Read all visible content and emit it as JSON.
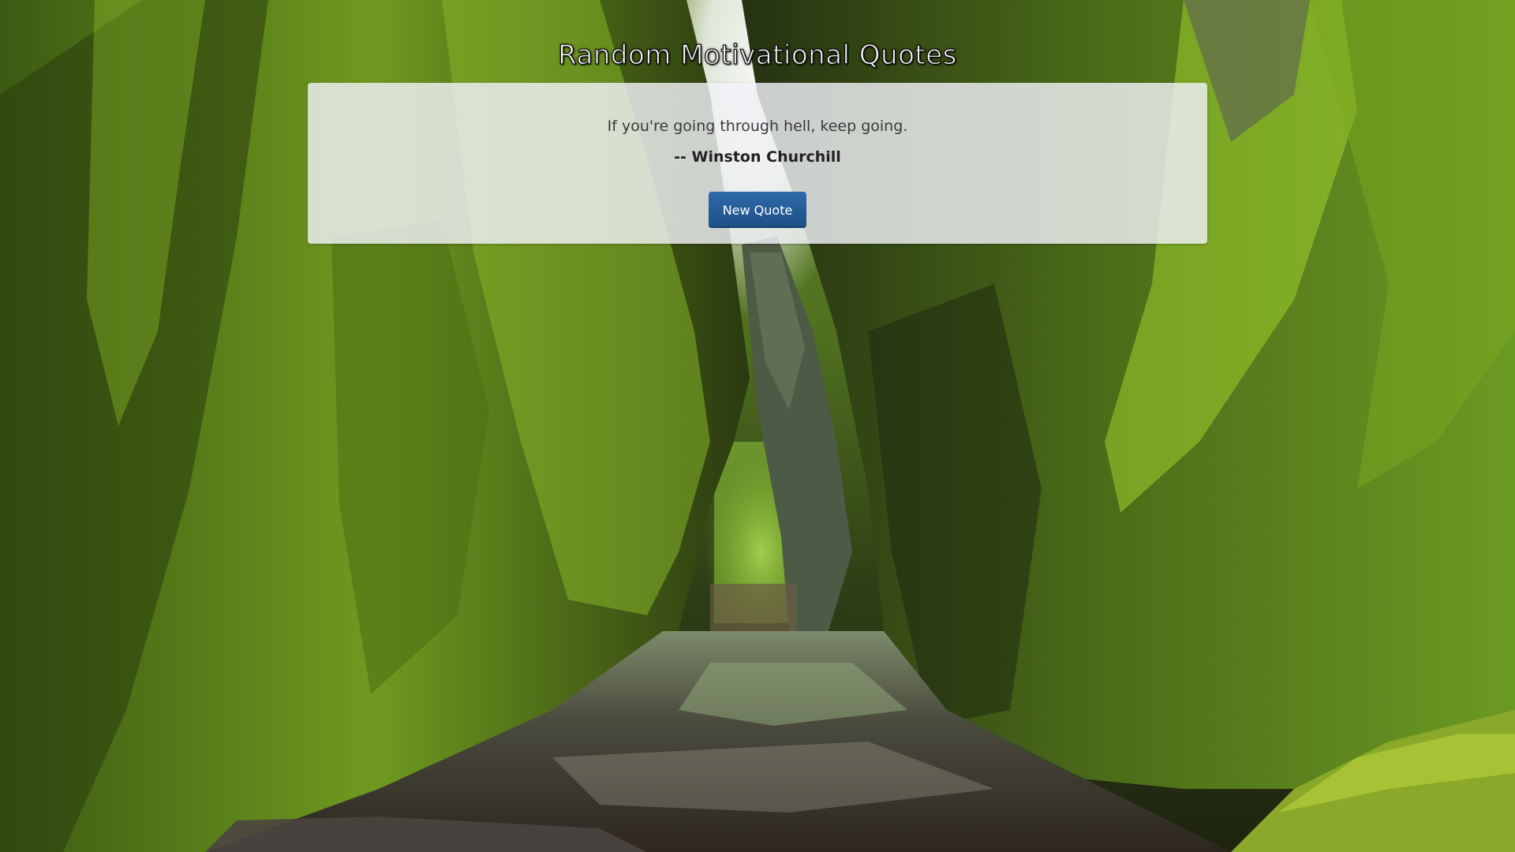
{
  "page": {
    "title": "Random Motivational Quotes"
  },
  "quote": {
    "text": "If you're going through hell, keep going.",
    "author": "-- Winston Churchill"
  },
  "controls": {
    "new_quote_label": "New Quote"
  },
  "colors": {
    "button": "#1d4f86",
    "card_background": "#f0f2f6",
    "title_text": "#ffffff"
  }
}
